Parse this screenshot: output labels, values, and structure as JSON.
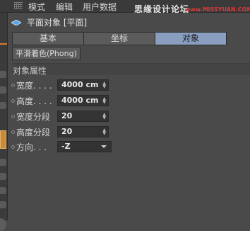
{
  "menubar": {
    "items": [
      "模式",
      "编辑",
      "用户数据"
    ],
    "watermark_cn": "思缘设计论坛",
    "watermark_url": "www.MISSYUAN.COM"
  },
  "panel": {
    "title": "平面对象 [平面]",
    "tabs": [
      {
        "label": "基本",
        "active": false
      },
      {
        "label": "坐标",
        "active": false
      },
      {
        "label": "对象",
        "active": true
      }
    ],
    "phong_button": "平滑着色(Phong)",
    "section_title": "对象属性",
    "fields": [
      {
        "label": "宽度. . . .",
        "value": "4000 cm"
      },
      {
        "label": "高度. . . .",
        "value": "4000 cm"
      },
      {
        "label": "宽度分段",
        "value": "20"
      },
      {
        "label": "高度分段",
        "value": "20"
      }
    ],
    "orientation": {
      "label": "方向. . .",
      "value": "-Z"
    }
  },
  "colors": {
    "active_tab": "#8a9fc0",
    "panel_bg": "#4a4a4a",
    "field_bg": "#333333",
    "accent_orange": "#d57c2b"
  }
}
